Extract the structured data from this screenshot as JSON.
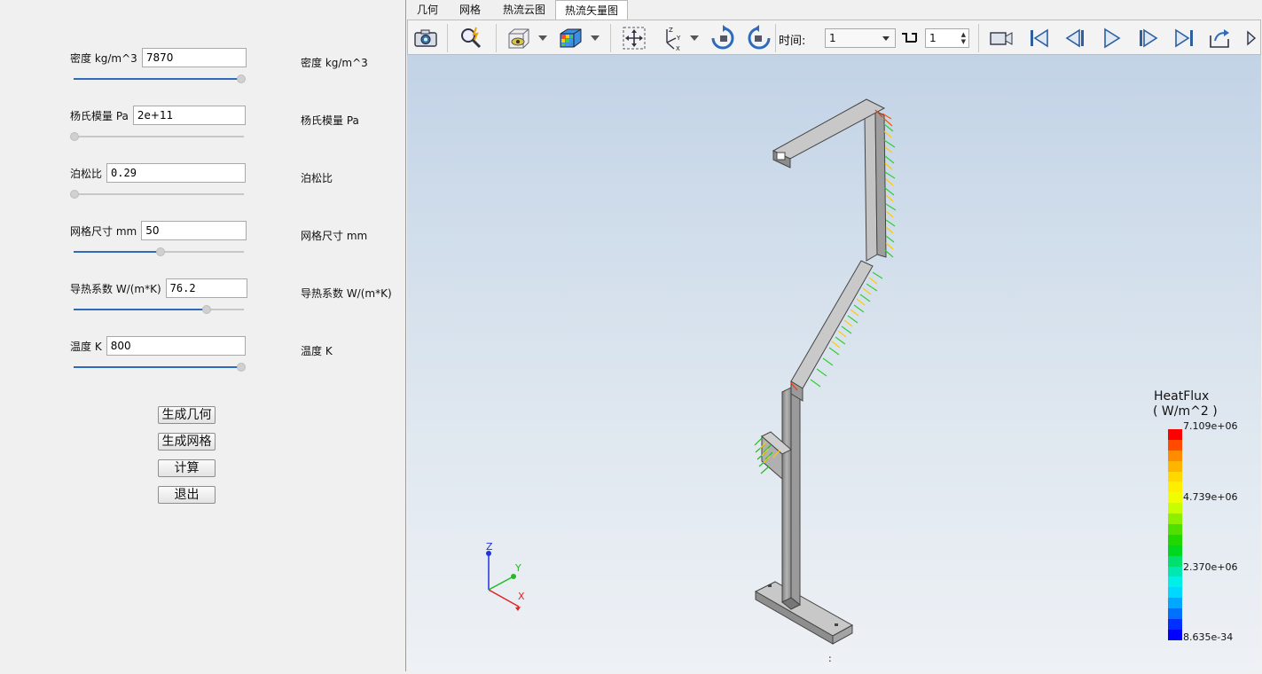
{
  "params": [
    {
      "label": "密度 kg/m^3",
      "value": "7870",
      "echo": "密度 kg/m^3",
      "slider_fraction": 1.0
    },
    {
      "label": "杨氏模量 Pa",
      "value": "2e+11",
      "echo": "杨氏模量 Pa",
      "slider_fraction": 0.0
    },
    {
      "label": "泊松比",
      "value": "0.29",
      "echo": "泊松比",
      "slider_fraction": 0.0
    },
    {
      "label": "网格尺寸 mm",
      "value": "50",
      "echo": "网格尺寸 mm",
      "slider_fraction": 0.5
    },
    {
      "label": "导热系数 W/(m*K)",
      "value": "76.2",
      "echo": "导热系数 W/(m*K)",
      "slider_fraction": 0.78
    },
    {
      "label": "温度 K",
      "value": "800",
      "echo": "温度 K",
      "slider_fraction": 1.0
    }
  ],
  "buttons": {
    "generate_geometry": "生成几何",
    "generate_mesh": "生成网格",
    "compute": "计算",
    "exit": "退出"
  },
  "tabs": [
    {
      "label": "几何",
      "active": false
    },
    {
      "label": "网格",
      "active": false
    },
    {
      "label": "热流云图",
      "active": false
    },
    {
      "label": "热流矢量图",
      "active": true
    }
  ],
  "toolbar": {
    "icons": [
      "camera-icon",
      "zoom-magic-icon",
      "box-visibility-icon",
      "cube-color-icon",
      "fit-view-icon",
      "axes-icon",
      "rotate-cw-icon",
      "rotate-ccw-icon",
      "record-icon",
      "first-frame-icon",
      "prev-frame-icon",
      "play-icon",
      "next-frame-icon",
      "last-frame-icon",
      "export-icon"
    ],
    "time_label": "时间:",
    "time_value": "1",
    "step_value": "1"
  },
  "colorbar": {
    "title_line1": "HeatFlux",
    "title_line2": "( W/m^2 )",
    "ticks": [
      "7.109e+06",
      "4.739e+06",
      "2.370e+06",
      "8.635e-34"
    ],
    "colors": [
      "#ff0000",
      "#ff4a00",
      "#ff8c00",
      "#ffb400",
      "#ffd800",
      "#ffee00",
      "#f0ff00",
      "#c8ff00",
      "#8cf000",
      "#50e000",
      "#20d800",
      "#00d820",
      "#00e070",
      "#00e8b0",
      "#00f0e8",
      "#00d8ff",
      "#00a8ff",
      "#0070ff",
      "#0030ff",
      "#0000ff"
    ]
  },
  "axes_triad": {
    "x": "X",
    "y": "Y",
    "z": "Z"
  },
  "colors": {
    "accent": "#2e6bbd",
    "viewport_top": "#c2d3e6",
    "viewport_bottom": "#eef1f5"
  }
}
